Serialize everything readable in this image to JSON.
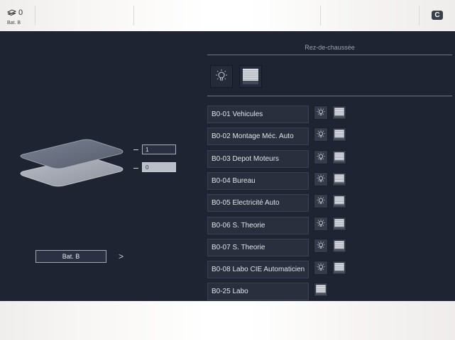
{
  "topbar": {
    "counter_value": "0",
    "building_label": "Bat. B",
    "logo_letter": "C"
  },
  "left": {
    "floors": [
      {
        "label": "1",
        "selected": false
      },
      {
        "label": "0",
        "selected": true
      }
    ],
    "building_button": "Bat. B",
    "next_chevron": ">"
  },
  "right": {
    "floor_title": "Rez-de-chaussée",
    "global_controls": [
      "light-icon",
      "shutter-icon"
    ],
    "rooms": [
      {
        "name": "B0-01 Vehicules",
        "controls": [
          "light",
          "shutter"
        ]
      },
      {
        "name": "B0-02 Montage Méc. Auto",
        "controls": [
          "light",
          "shutter"
        ]
      },
      {
        "name": "B0-03 Depot Moteurs",
        "controls": [
          "light",
          "shutter"
        ]
      },
      {
        "name": "B0-04 Bureau",
        "controls": [
          "light",
          "shutter"
        ]
      },
      {
        "name": "B0-05 Electricité Auto",
        "controls": [
          "light",
          "shutter"
        ]
      },
      {
        "name": "B0-06 S. Theorie",
        "controls": [
          "light",
          "shutter"
        ]
      },
      {
        "name": "B0-07 S. Theorie",
        "controls": [
          "light",
          "shutter"
        ]
      },
      {
        "name": "B0-08 Labo CIE Automaticien",
        "controls": [
          "light",
          "shutter"
        ]
      },
      {
        "name": "B0-25 Labo",
        "controls": [
          "shutter"
        ]
      }
    ]
  },
  "colors": {
    "background": "#1f2433",
    "panel": "#2a2f3e",
    "bar": "#ffffff"
  }
}
